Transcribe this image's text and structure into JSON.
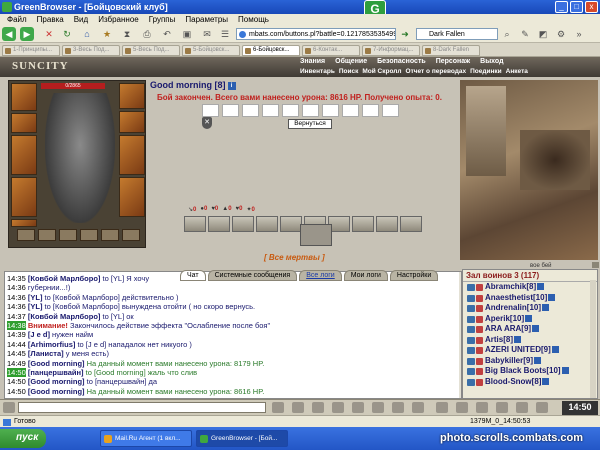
{
  "window": {
    "title": "GreenBrowser - [Бойцовский клуб]",
    "controls": [
      "_",
      "□",
      "x"
    ]
  },
  "menu": [
    "Файл",
    "Правка",
    "Вид",
    "Избранное",
    "Группы",
    "Параметры",
    "Помощь"
  ],
  "address": {
    "url": "mbats.com/buttons.pl?battle=0.121785353549956",
    "search": "Dark Fallen"
  },
  "tabs": [
    "1-Принципы...",
    "3-Весь Под...",
    "5-Весь Под...",
    "5-Бойцовск...",
    "6-Бойцовск...",
    "6-Контак...",
    "7-Информац...",
    "8-Dark Fallen"
  ],
  "game": {
    "logo": "SUNCITY",
    "nav_top": [
      "Знания",
      "Общение",
      "Безопасность",
      "Персонаж",
      "Выход"
    ],
    "nav_sub": [
      "Инвентарь",
      "Поиск",
      "Мой Скролл",
      "Отчет о переводах",
      "Поединки",
      "Анкета"
    ],
    "hp": "0/2865",
    "player_title": "Good morning [8]",
    "fight_result": "Бой закончен. Всего вами нанесено урона: 8616 HP. Получено опыта: 0.",
    "back_button": "Вернуться",
    "all_dead": "[ Все мертвы ]",
    "last_page": "вое бей",
    "stats": [
      {
        "v": "0"
      },
      {
        "v": "0"
      },
      {
        "v": "0"
      },
      {
        "v": "0"
      },
      {
        "v": "0"
      },
      {
        "v": "0"
      }
    ]
  },
  "chat_tabs": [
    "Чат",
    "Системные сообщения",
    "Все логи",
    "Мои логи",
    "Настройки"
  ],
  "chat": [
    {
      "time": "14:35",
      "nick": "[Ковбой Марлборо]",
      "text": " to [YL] Я хочу ",
      "hl": false
    },
    {
      "time": "14:36",
      "nick": "",
      "text": "губернии...!)",
      "hl": false
    },
    {
      "time": "14:36",
      "nick": "[YL]",
      "text": " to [Ковбой Марлборо] действительно )",
      "hl": false
    },
    {
      "time": "14:36",
      "nick": "[YL]",
      "text": " to [Ковбой Марлборо] вынуждена отойти ( но скоро вернусь.",
      "hl": false
    },
    {
      "time": "14:37",
      "nick": "[Ковбой Марлборо]",
      "text": " to [YL] ок",
      "hl": false
    },
    {
      "time": "14:38",
      "nick": "",
      "sys": "Внимание!",
      "text": " Закончилось действие эффекта \"Ослабление после боя\"",
      "hl": true
    },
    {
      "time": "14:39",
      "nick": "[J e d]",
      "text": " нужен найм",
      "hl": false
    },
    {
      "time": "14:44",
      "nick": "[Arhimorfius]",
      "text": " to [J e d] нападалок нет никуого )",
      "hl": false
    },
    {
      "time": "14:45",
      "nick": "[Ланиста]",
      "text": " у меня есть)",
      "hl": false
    },
    {
      "time": "14:49",
      "nick": "[Good morning]",
      "text": " На данный момент вами нанесено урона: 8179 HP.",
      "hl": false
    },
    {
      "time": "14:50",
      "nick": "[панцершвайн]",
      "text": " to [Good morning] жаль что слив",
      "hl": true
    },
    {
      "time": "14:50",
      "nick": "[Good morning]",
      "text": " to [панцершвайн] да",
      "hl": false
    },
    {
      "time": "14:50",
      "nick": "[Good morning]",
      "text": " На данный момент вами нанесено урона: 8616 HP.",
      "hl": false
    }
  ],
  "players": {
    "header": "Зал воинов 3 (117)",
    "list": [
      "Abramchik[8]",
      "Anaesthetist[10]",
      "Andrenalin[10]",
      "Aperik[10]",
      "ARA ARA[9]",
      "Artis[8]",
      "AZERI UNITED[9]",
      "Babykiller[9]",
      "Big Black Boots[10]",
      "Blood-Snow[8]"
    ]
  },
  "clock": "14:50",
  "status": {
    "left": "Готово",
    "right": "1379M_0_14:50:53"
  },
  "taskbar": {
    "start": "пуск",
    "items": [
      "Mail.Ru Агент (1 вкл...",
      "GreenBrowser - [Бой..."
    ]
  },
  "watermark": "photo.scrolls.combats.com"
}
